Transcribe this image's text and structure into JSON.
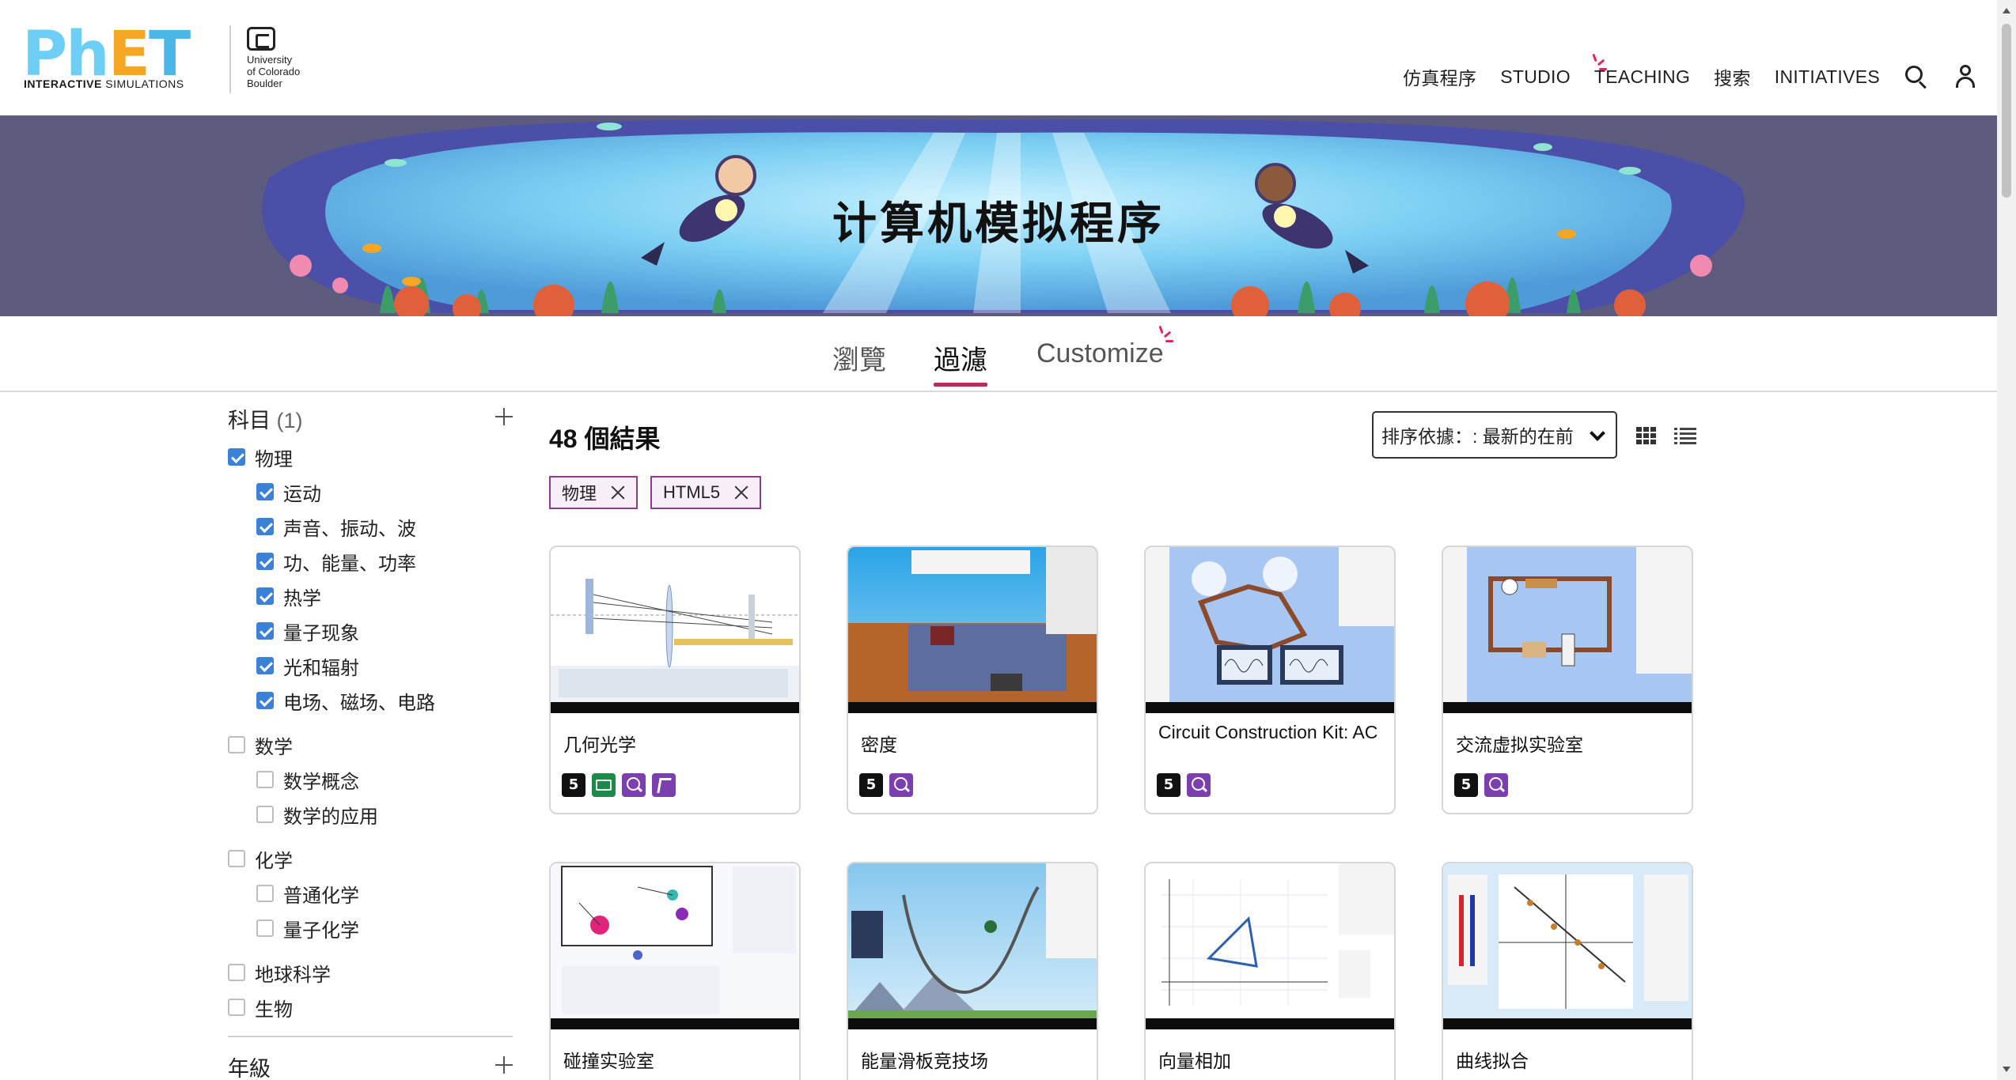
{
  "header": {
    "logo": {
      "part1": "Ph",
      "part2": "E",
      "part3": "T",
      "sub_bold": "INTERACTIVE",
      "sub_rest": " SIMULATIONS",
      "university_line1": "University",
      "university_line2": "of Colorado",
      "university_line3": "Boulder"
    },
    "nav": [
      "仿真程序",
      "STUDIO",
      "TEACHING",
      "搜索",
      "INITIATIVES"
    ],
    "search_icon": "search-icon",
    "account_icon": "user-icon"
  },
  "banner": {
    "title": "计算机模拟程序"
  },
  "tabs": {
    "browse": "瀏覽",
    "filter": "過濾",
    "customize": "Customize",
    "active": "filter"
  },
  "sidebar": {
    "subject_label": "科目",
    "subject_count": "(1)",
    "groups": [
      {
        "label": "物理",
        "checked": true,
        "children": [
          {
            "label": "运动",
            "checked": true
          },
          {
            "label": "声音、振动、波",
            "checked": true
          },
          {
            "label": "功、能量、功率",
            "checked": true
          },
          {
            "label": "热学",
            "checked": true
          },
          {
            "label": "量子现象",
            "checked": true
          },
          {
            "label": "光和辐射",
            "checked": true
          },
          {
            "label": "电场、磁场、电路",
            "checked": true
          }
        ]
      },
      {
        "label": "数学",
        "checked": false,
        "children": [
          {
            "label": "数学概念",
            "checked": false
          },
          {
            "label": "数学的应用",
            "checked": false
          }
        ]
      },
      {
        "label": "化学",
        "checked": false,
        "children": [
          {
            "label": "普通化学",
            "checked": false
          },
          {
            "label": "量子化学",
            "checked": false
          }
        ]
      },
      {
        "label": "地球科学",
        "checked": false,
        "children": []
      },
      {
        "label": "生物",
        "checked": false,
        "children": []
      }
    ],
    "grade_label": "年級"
  },
  "main": {
    "results": "48 個結果",
    "sort_label": "排序依據：: 最新的在前",
    "chips": [
      "物理",
      "HTML5"
    ],
    "cards": [
      {
        "title": "几何光学",
        "icons": [
          "html5",
          "kbd",
          "zoom",
          "touch"
        ]
      },
      {
        "title": "密度",
        "icons": [
          "html5",
          "zoom"
        ]
      },
      {
        "title": "Circuit Construction Kit: AC",
        "icons": [
          "html5",
          "zoom"
        ]
      },
      {
        "title": "交流虚拟实验室",
        "icons": [
          "html5",
          "zoom"
        ]
      },
      {
        "title": "碰撞实验室",
        "icons": []
      },
      {
        "title": "能量滑板竞技场",
        "icons": []
      },
      {
        "title": "向量相加",
        "icons": []
      },
      {
        "title": "曲线拟合",
        "icons": []
      }
    ]
  },
  "colors": {
    "accent": "#b32e5f",
    "chip_border": "#8a3d8f",
    "checkbox": "#3b82d6"
  }
}
